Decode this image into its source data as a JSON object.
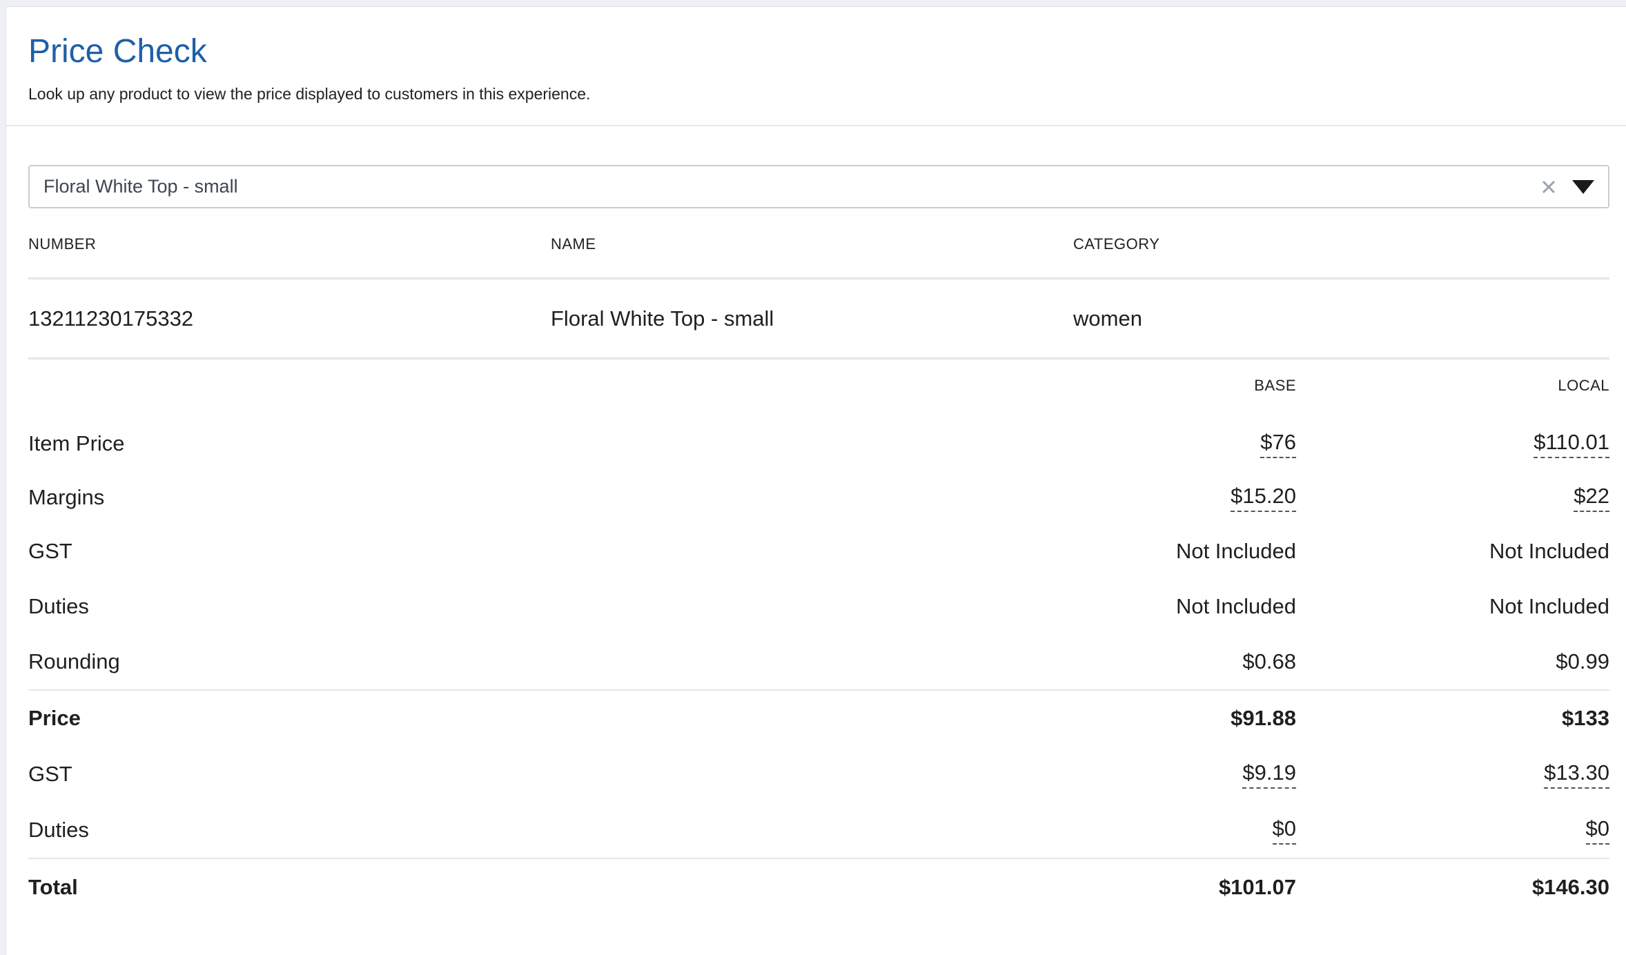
{
  "header": {
    "title": "Price Check",
    "subtitle": "Look up any product to view the price displayed to customers in this experience."
  },
  "product_select": {
    "value": "Floral White Top - small"
  },
  "product_table": {
    "columns": [
      "NUMBER",
      "NAME",
      "CATEGORY"
    ],
    "row": {
      "number": "13211230175332",
      "name": "Floral White Top - small",
      "category": "women"
    }
  },
  "price_table": {
    "columns": {
      "base": "BASE",
      "local": "LOCAL"
    },
    "rows": {
      "item_price": {
        "label": "Item Price",
        "base": "$76",
        "local": "$110.01"
      },
      "margins": {
        "label": "Margins",
        "base": "$15.20",
        "local": "$22"
      },
      "gst": {
        "label": "GST",
        "base": "Not Included",
        "local": "Not Included"
      },
      "duties": {
        "label": "Duties",
        "base": "Not Included",
        "local": "Not Included"
      },
      "rounding": {
        "label": "Rounding",
        "base": "$0.68",
        "local": "$0.99"
      },
      "price": {
        "label": "Price",
        "base": "$91.88",
        "local": "$133"
      },
      "gst_amount": {
        "label": "GST",
        "base": "$9.19",
        "local": "$13.30"
      },
      "duties_amount": {
        "label": "Duties",
        "base": "$0",
        "local": "$0"
      },
      "total": {
        "label": "Total",
        "base": "$101.07",
        "local": "$146.30"
      }
    }
  },
  "icons": {
    "clear": "close-icon",
    "dropdown": "caret-down-icon"
  },
  "colors": {
    "title": "#1e5fa8",
    "border": "#c8cdd3"
  }
}
